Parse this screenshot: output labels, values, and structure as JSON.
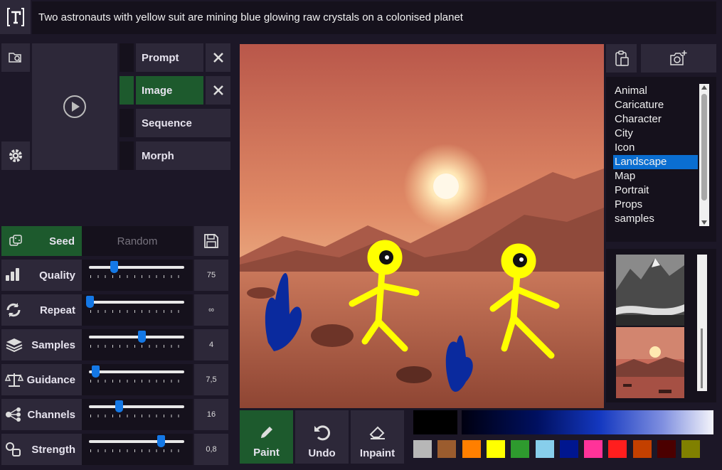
{
  "prompt": {
    "text": "Two astronauts with yellow suit are mining blue glowing raw crystals on a colonised planet"
  },
  "modes": [
    {
      "label": "Prompt",
      "active": false,
      "closable": true
    },
    {
      "label": "Image",
      "active": true,
      "closable": true
    },
    {
      "label": "Sequence",
      "active": false,
      "closable": false
    },
    {
      "label": "Morph",
      "active": false,
      "closable": false
    }
  ],
  "seed": {
    "label": "Seed",
    "value_placeholder": "Random"
  },
  "sliders": [
    {
      "label": "Quality",
      "icon": "bars-icon",
      "value": "75",
      "position": 0.27
    },
    {
      "label": "Repeat",
      "icon": "repeat-icon",
      "value": "∞",
      "position": 0.0
    },
    {
      "label": "Samples",
      "icon": "layers-icon",
      "value": "4",
      "position": 0.58
    },
    {
      "label": "Guidance",
      "icon": "scale-icon",
      "value": "7,5",
      "position": 0.06
    },
    {
      "label": "Channels",
      "icon": "channels-icon",
      "value": "16",
      "position": 0.33
    },
    {
      "label": "Strength",
      "icon": "strength-icon",
      "value": "0,8",
      "position": 0.8
    }
  ],
  "categories": [
    "Animal",
    "Caricature",
    "Character",
    "City",
    "Icon",
    "Landscape",
    "Map",
    "Portrait",
    "Props",
    "samples"
  ],
  "selected_category": "Landscape",
  "tools": [
    {
      "label": "Paint",
      "icon": "pencil-icon",
      "active": true
    },
    {
      "label": "Undo",
      "icon": "undo-icon",
      "active": false
    },
    {
      "label": "Inpaint",
      "icon": "eraser-icon",
      "active": false
    }
  ],
  "palette": [
    "#b7b7b7",
    "#9b5c2e",
    "#ff7f00",
    "#ffff00",
    "#2e9a2e",
    "#87ceeb",
    "#00168f",
    "#ff3399",
    "#ff1e1e",
    "#c34000",
    "#4b0000",
    "#808000"
  ],
  "current_color": "#000000",
  "colors": {
    "accent": "#1478e6",
    "active_green": "#1d5a2d",
    "panel": "#2d2839"
  }
}
